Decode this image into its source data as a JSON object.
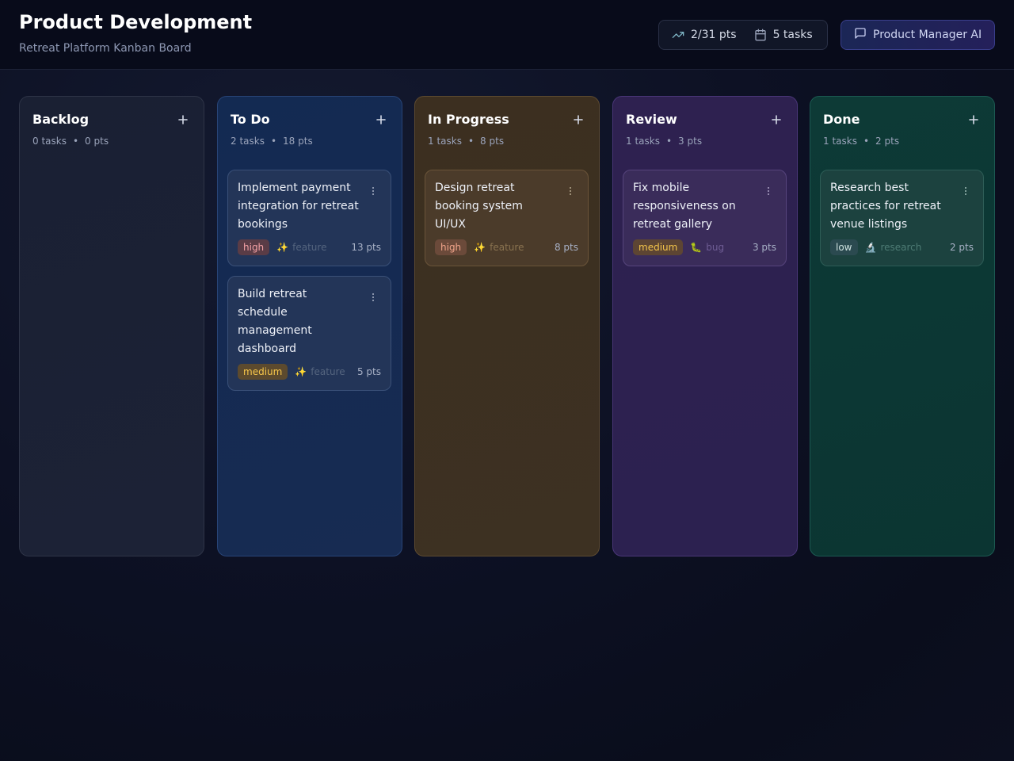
{
  "header": {
    "title": "Product Development",
    "subtitle": "Retreat Platform Kanban Board",
    "points_stat": "2/31 pts",
    "tasks_stat": "5 tasks",
    "ai_button": "Product Manager AI"
  },
  "columns": [
    {
      "title": "Backlog",
      "task_count": "0 tasks",
      "points": "0 pts",
      "cards": []
    },
    {
      "title": "To Do",
      "task_count": "2 tasks",
      "points": "18 pts",
      "cards": [
        {
          "title": "Implement payment integration for retreat bookings",
          "priority": "high",
          "type": "feature",
          "type_icon": "✨",
          "points": "13 pts"
        },
        {
          "title": "Build retreat schedule management dashboard",
          "priority": "medium",
          "type": "feature",
          "type_icon": "✨",
          "points": "5 pts"
        }
      ]
    },
    {
      "title": "In Progress",
      "task_count": "1 tasks",
      "points": "8 pts",
      "cards": [
        {
          "title": "Design retreat booking system UI/UX",
          "priority": "high",
          "type": "feature",
          "type_icon": "✨",
          "points": "8 pts"
        }
      ]
    },
    {
      "title": "Review",
      "task_count": "1 tasks",
      "points": "3 pts",
      "cards": [
        {
          "title": "Fix mobile responsiveness on retreat gallery",
          "priority": "medium",
          "type": "bug",
          "type_icon": "🐛",
          "points": "3 pts"
        }
      ]
    },
    {
      "title": "Done",
      "task_count": "1 tasks",
      "points": "2 pts",
      "cards": [
        {
          "title": "Research best practices for retreat venue listings",
          "priority": "low",
          "type": "research",
          "type_icon": "🔬",
          "points": "2 pts"
        }
      ]
    }
  ],
  "colors": {
    "background": "#0d1124",
    "todo_column": "#172b52",
    "in_progress_column": "#3d3122",
    "review_column": "#2c2150",
    "done_column": "#0b3532",
    "priority_high": "#f4a2a6",
    "priority_medium": "#f7c64a"
  },
  "icons": {
    "points_stat": "trending-up-icon",
    "tasks_stat": "calendar-icon",
    "ai_button": "message-square-icon",
    "column_add": "plus-icon",
    "card_menu": "vertical-dots-icon"
  }
}
